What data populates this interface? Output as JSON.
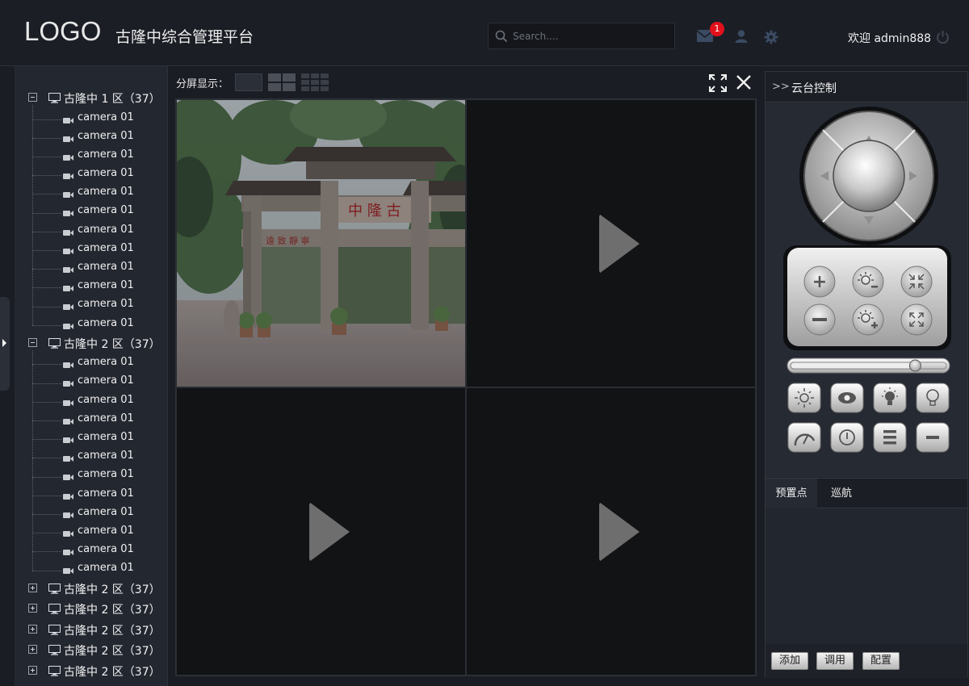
{
  "header": {
    "logo": "LOGO",
    "title": "古隆中综合管理平台",
    "search_placeholder": "Search....",
    "mail_badge": "1",
    "welcome": "欢迎 admin888"
  },
  "icons": {
    "search": "search-icon",
    "mail": "mail-icon",
    "user": "user-icon",
    "settings": "gear-icon",
    "power": "power-icon"
  },
  "tree": {
    "expanded": [
      {
        "label": "古隆中 1 区（37）",
        "cameras": [
          "camera 01",
          "camera 01",
          "camera 01",
          "camera 01",
          "camera 01",
          "camera 01",
          "camera 01",
          "camera 01",
          "camera 01",
          "camera 01",
          "camera 01",
          "camera 01"
        ]
      },
      {
        "label": "古隆中 2 区（37）",
        "cameras": [
          "camera 01",
          "camera 01",
          "camera 01",
          "camera 01",
          "camera 01",
          "camera 01",
          "camera 01",
          "camera 01",
          "camera 01",
          "camera 01",
          "camera 01",
          "camera 01"
        ]
      }
    ],
    "collapsed": [
      "古隆中 2 区（37）",
      "古隆中 2 区（37）",
      "古隆中 2 区（37）",
      "古隆中 2 区（37）",
      "古隆中 2 区（37）"
    ]
  },
  "toolbar": {
    "split_label": "分屏显示：",
    "fullscreen": "fullscreen-icon",
    "close": "close-icon"
  },
  "colors": {
    "background": "#1a1d24",
    "panel": "#232730",
    "badge": "#e3101b",
    "play": "#6e6e6e"
  },
  "ptz": {
    "title": "云台控制",
    "slider_value": 0.8
  },
  "tabs": [
    "预置点",
    "巡航"
  ],
  "actions": [
    "添加",
    "调用",
    "配置"
  ]
}
